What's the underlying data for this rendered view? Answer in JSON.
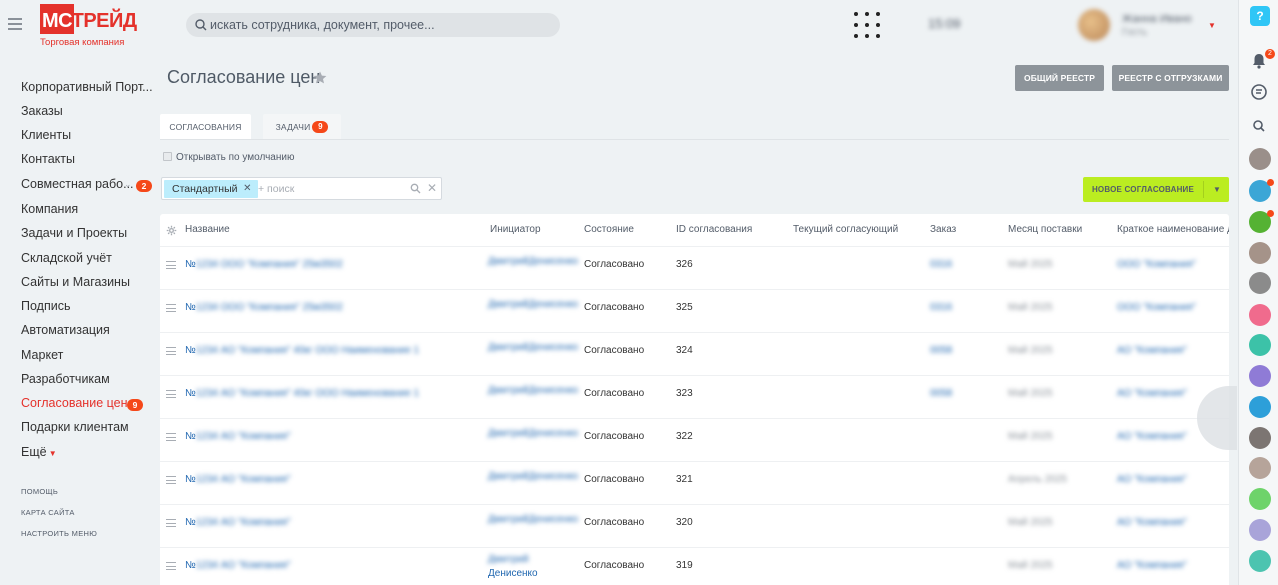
{
  "header": {
    "logo_main": "МСТРЕЙД",
    "logo_sub": "Торговая компания",
    "search_placeholder": "искать сотрудника, документ, прочее...",
    "clock": "15:09",
    "user_name": "Жанна Ивано",
    "user_status": "Гость"
  },
  "nav": {
    "items": [
      {
        "label": "Корпоративный Порт..."
      },
      {
        "label": "Заказы"
      },
      {
        "label": "Клиенты"
      },
      {
        "label": "Контакты"
      },
      {
        "label": "Совместная рабо...",
        "badge": "2"
      },
      {
        "label": "Компания"
      },
      {
        "label": "Задачи и Проекты"
      },
      {
        "label": "Складской учёт"
      },
      {
        "label": "Сайты и Магазины"
      },
      {
        "label": "Подпись"
      },
      {
        "label": "Автоматизация"
      },
      {
        "label": "Маркет"
      },
      {
        "label": "Разработчикам"
      },
      {
        "label": "Согласование цен",
        "badge": "9"
      },
      {
        "label": "Подарки клиентам"
      },
      {
        "label": "Ещё"
      }
    ],
    "footer": [
      "ПОМОЩЬ",
      "КАРТА САЙТА",
      "НАСТРОИТЬ МЕНЮ"
    ]
  },
  "page": {
    "title": "Согласование цен",
    "btn_registry": "ОБЩИЙ РЕЕСТР",
    "btn_registry_shipments": "РЕЕСТР С ОТГРУЗКАМИ",
    "tabs": [
      {
        "label": "СОГЛАСОВАНИЯ"
      },
      {
        "label": "ЗАДАЧИ",
        "badge": "9"
      }
    ],
    "open_default": "Открывать по умолчанию",
    "filter_tag": "Стандартный",
    "filter_placeholder": "+ поиск",
    "btn_new": "НОВОЕ СОГЛАСОВАНИЕ",
    "right_bell_badge": "2"
  },
  "grid": {
    "columns": [
      "Название",
      "Инициатор",
      "Состояние",
      "ID согласования",
      "Текущий согласующий",
      "Заказ",
      "Месяц поставки",
      "Краткое наименование де"
    ],
    "rows": [
      {
        "prefix": "№",
        "name": "1234 ООО \"Компания\" 25м3502",
        "init1": "Дмитрий",
        "init2": "Денисенко",
        "state": "Согласовано",
        "id": "326",
        "order": "0316",
        "month": "Май 2025",
        "short": "ООО \"Компания\""
      },
      {
        "prefix": "№",
        "name": "1234 ООО \"Компания\" 25м3502",
        "init1": "Дмитрий",
        "init2": "Денисенко",
        "state": "Согласовано",
        "id": "325",
        "order": "0316",
        "month": "Май 2025",
        "short": "ООО \"Компания\""
      },
      {
        "prefix": "№",
        "name": "1234 АО \"Компания\" 40кг ООО Наименование 1",
        "init1": "Дмитрий",
        "init2": "Денисенко",
        "state": "Согласовано",
        "id": "324",
        "order": "0058",
        "month": "Май 2025",
        "short": "АО \"Компания\""
      },
      {
        "prefix": "№",
        "name": "1234 АО \"Компания\" 40кг ООО Наименование 1",
        "init1": "Дмитрий",
        "init2": "Денисенко",
        "state": "Согласовано",
        "id": "323",
        "order": "0058",
        "month": "Май 2025",
        "short": "АО \"Компания\""
      },
      {
        "prefix": "№",
        "name": "1234 АО \"Компания\"",
        "init1": "Дмитрий",
        "init2": "Денисенко",
        "state": "Согласовано",
        "id": "322",
        "order": "",
        "month": "Май 2025",
        "short": "АО \"Компания\""
      },
      {
        "prefix": "№",
        "name": "1234 АО \"Компания\"",
        "init1": "Дмитрий",
        "init2": "Денисенко",
        "state": "Согласовано",
        "id": "321",
        "order": "",
        "month": "Апрель 2025",
        "short": "АО \"Компания\""
      },
      {
        "prefix": "№",
        "name": "1234 АО \"Компания\"",
        "init1": "Дмитрий",
        "init2": "Денисенко",
        "state": "Согласовано",
        "id": "320",
        "order": "",
        "month": "Май 2025",
        "short": "АО \"Компания\""
      },
      {
        "prefix": "№",
        "name": "1234 АО \"Компания\"",
        "init1": "Дмитрий",
        "init2": "Денисенко",
        "state": "Согласовано",
        "id": "319",
        "order": "",
        "month": "Май 2025",
        "short": "АО \"Компания\""
      }
    ]
  },
  "colors": {
    "brand_red": "#e4322b",
    "accent_green": "#bbed21",
    "link_blue": "#2067b0",
    "badge": "#f54819"
  }
}
